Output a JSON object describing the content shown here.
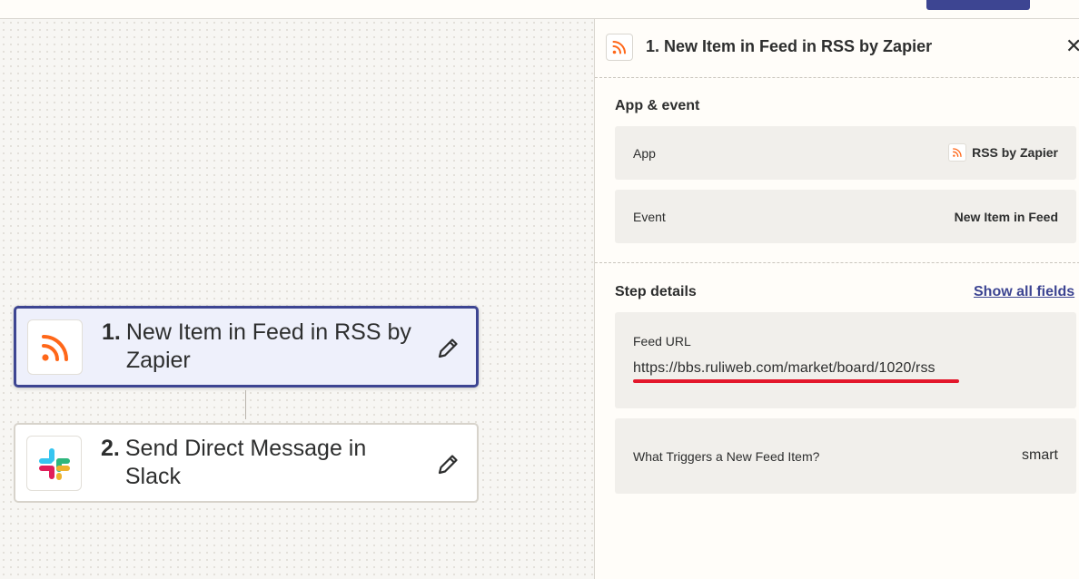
{
  "colors": {
    "accent": "#3d4592",
    "rss_orange": "#ff6719",
    "annotation_red": "#e3172b"
  },
  "steps": [
    {
      "number": "1.",
      "title": "New Item in Feed in RSS by Zapier",
      "icon": "rss-icon",
      "selected": true
    },
    {
      "number": "2.",
      "title": "Send Direct Message in Slack",
      "icon": "slack-icon",
      "selected": false
    }
  ],
  "panel": {
    "title": "1. New Item in Feed in RSS by Zapier",
    "app_event": {
      "section_title": "App & event",
      "app_label": "App",
      "app_value": "RSS by Zapier",
      "event_label": "Event",
      "event_value": "New Item in Feed"
    },
    "step_details": {
      "section_title": "Step details",
      "show_all_label": "Show all fields",
      "feed_url_label": "Feed URL",
      "feed_url_value": "https://bbs.ruliweb.com/market/board/1020/rss",
      "trigger_label": "What Triggers a New Feed Item?",
      "trigger_value": "smart"
    }
  }
}
